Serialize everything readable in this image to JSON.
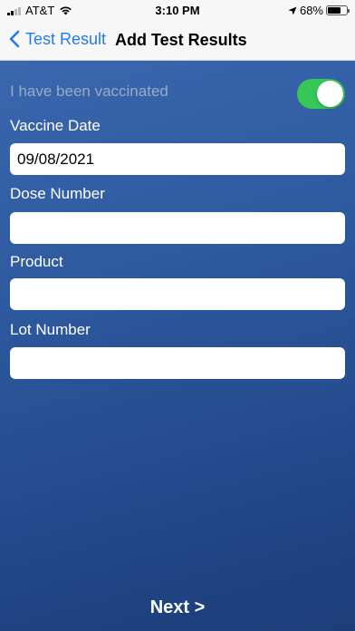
{
  "status_bar": {
    "carrier": "AT&T",
    "time": "3:10 PM",
    "battery_percent": "68%",
    "battery_level": 0.68,
    "signal_bars": 2
  },
  "nav": {
    "back_label": "Test Result",
    "title": "Add Test Results"
  },
  "form": {
    "vaccinated_label": "I have been vaccinated",
    "vaccinated_on": true,
    "vaccine_date_label": "Vaccine Date",
    "vaccine_date_value": "09/08/2021",
    "dose_number_label": "Dose Number",
    "dose_number_value": "",
    "product_label": "Product",
    "product_value": "",
    "lot_number_label": "Lot Number",
    "lot_number_value": ""
  },
  "footer": {
    "next_label": "Next >"
  },
  "colors": {
    "accent": "#1e7cf4",
    "toggle_on": "#36c759",
    "background_top": "#3a66ad",
    "background_bottom": "#1c3d78"
  }
}
